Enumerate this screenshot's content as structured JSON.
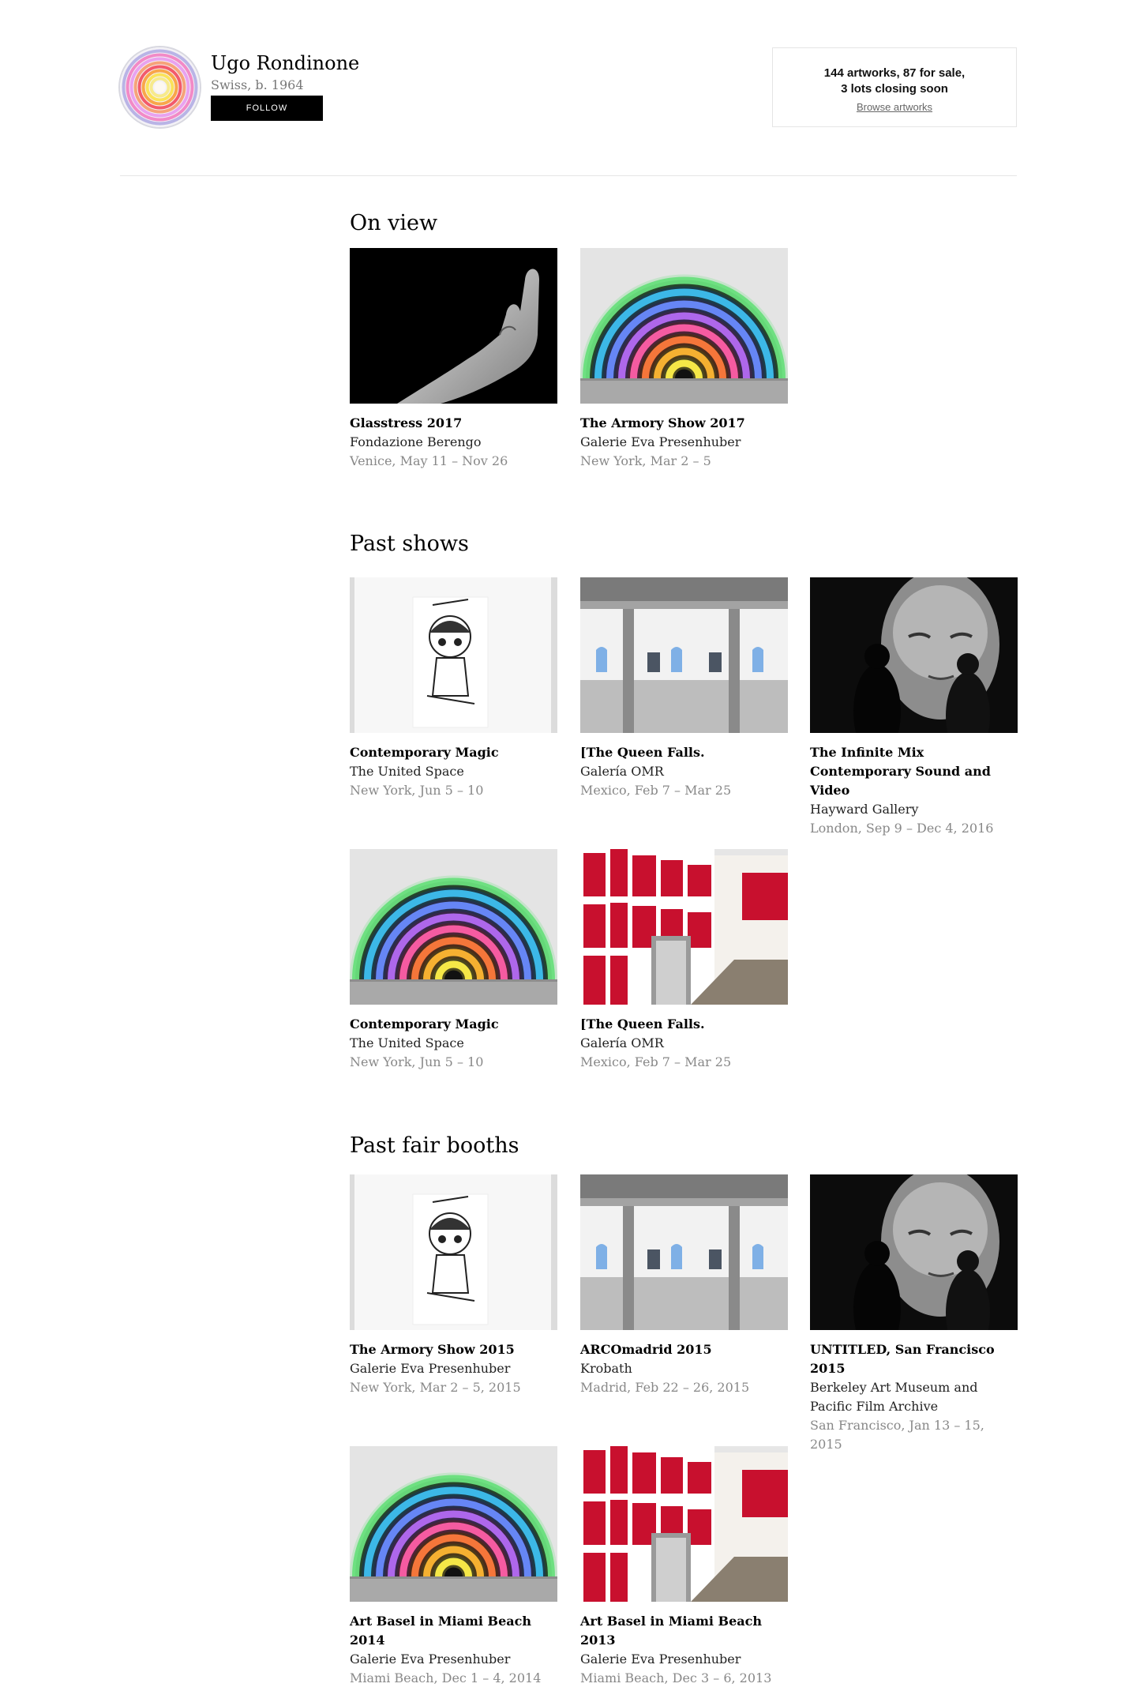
{
  "artist": {
    "name": "Ugo Rondinone",
    "meta": "Swiss, b. 1964",
    "follow_label": "FOLLOW"
  },
  "stats": {
    "line1": "144 artworks, 87 for sale,",
    "line2": "3 lots closing soon",
    "browse_label": "Browse artworks"
  },
  "sections": {
    "on_view": {
      "title": "On view",
      "items": [
        {
          "title": "Glasstress 2017",
          "venue": "Fondazione Berengo",
          "when": "Venice, May 11 – Nov 26",
          "image": "hand"
        },
        {
          "title": "The Armory Show 2017",
          "venue": "Galerie Eva Presenhuber",
          "when": "New York, Mar 2 – 5",
          "image": "rainbow"
        }
      ]
    },
    "past_shows": {
      "title": "Past shows",
      "items": [
        {
          "title": "Contemporary Magic",
          "venue": "The United Space",
          "when": "New York, Jun 5 – 10",
          "image": "drawing"
        },
        {
          "title": "[The Queen Falls.",
          "venue": "Galería OMR",
          "when": "Mexico, Feb 7 – Mar 25",
          "image": "gallery"
        },
        {
          "title": "The Infinite Mix Contemporary Sound and Video",
          "venue": "Hayward Gallery",
          "when": "London, Sep 9 – Dec 4, 2016",
          "image": "portrait"
        },
        {
          "title": "Contemporary Magic",
          "venue": "The United Space",
          "when": "New York, Jun 5 – 10",
          "image": "rainbow"
        },
        {
          "title": "[The Queen Falls.",
          "venue": "Galería OMR",
          "when": "Mexico, Feb 7 – Mar 25",
          "image": "giorno"
        }
      ]
    },
    "past_fairs": {
      "title": "Past fair booths",
      "items": [
        {
          "title": "The Armory Show 2015",
          "venue": "Galerie Eva Presenhuber",
          "when": "New York, Mar 2 – 5, 2015",
          "image": "drawing"
        },
        {
          "title": "ARCOmadrid 2015",
          "venue": "Krobath",
          "when": "Madrid, Feb 22 – 26, 2015",
          "image": "gallery"
        },
        {
          "title": "UNTITLED, San Francisco 2015",
          "venue": "Berkeley Art Museum and Pacific Film Archive",
          "when": "San Francisco, Jan 13 – 15, 2015",
          "image": "portrait"
        },
        {
          "title": "Art Basel in Miami Beach 2014",
          "venue": "Galerie Eva Presenhuber",
          "when": "Miami Beach, Dec 1 – 4, 2014",
          "image": "rainbow"
        },
        {
          "title": "Art Basel in Miami Beach 2013",
          "venue": "Galerie Eva Presenhuber",
          "when": "Miami Beach, Dec 3 – 6, 2013",
          "image": "giorno"
        }
      ]
    }
  },
  "colors": {
    "accent": "#000000",
    "muted_text": "#888888",
    "divider": "#e5e5e5",
    "giorno_red": "#c8102e"
  }
}
